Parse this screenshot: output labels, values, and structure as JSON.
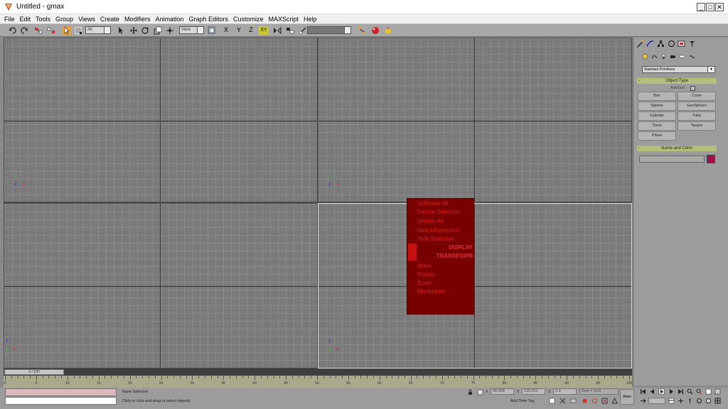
{
  "window": {
    "title": "Untitled - gmax",
    "minimize": "_",
    "maximize": "□",
    "close": "✕"
  },
  "menu": [
    "File",
    "Edit",
    "Tools",
    "Group",
    "Views",
    "Create",
    "Modifiers",
    "Animation",
    "Graph Editors",
    "Customize",
    "MAXScript",
    "Help"
  ],
  "toolbar": {
    "selection_filter": "All",
    "reference_coord": "View",
    "named_selection": "",
    "axis_constraints": [
      "X",
      "Y",
      "Z",
      "XY"
    ]
  },
  "viewports": {
    "axis_labels": {
      "x": "x",
      "y": "y",
      "z": "z"
    }
  },
  "quad_menu": {
    "items": [
      "Unfreeze All",
      "Freeze Selection",
      "Unhide All",
      "Hide Unselected",
      "Hide Selection"
    ],
    "display_header": "DISPLAY",
    "transform_header": "TRANSFORM",
    "transform_items": [
      "Move",
      "Rotate",
      "Scale",
      "Manipulate"
    ]
  },
  "command_panel": {
    "category": "Standard Primitives",
    "object_type_title": "Object Type",
    "autogrid": "AutoGrid",
    "buttons": [
      "Box",
      "Cone",
      "Sphere",
      "GeoSphere",
      "Cylinder",
      "Tube",
      "Torus",
      "Teapot",
      "Plane"
    ],
    "name_color_title": "Name and Color",
    "swatch_color": "#a0104a"
  },
  "time_slider": {
    "label": "0 / 100"
  },
  "trackbar": {
    "ticks": [
      "0",
      "5",
      "10",
      "15",
      "20",
      "25",
      "30",
      "35",
      "40",
      "45",
      "50",
      "55",
      "60",
      "65",
      "70",
      "75",
      "80",
      "85",
      "90",
      "95",
      "100"
    ]
  },
  "status": {
    "selection": "None Selected",
    "prompt": "Click or click-and-drag to select objects",
    "x_label": "X",
    "x_value": "68.958",
    "y_label": "Y",
    "y_value": "135.812",
    "z_label": "Z",
    "z_value": "0.0",
    "grid": "Grid = 10.0",
    "add_time_tag": "Add Time Tag",
    "anim": "Anim"
  }
}
